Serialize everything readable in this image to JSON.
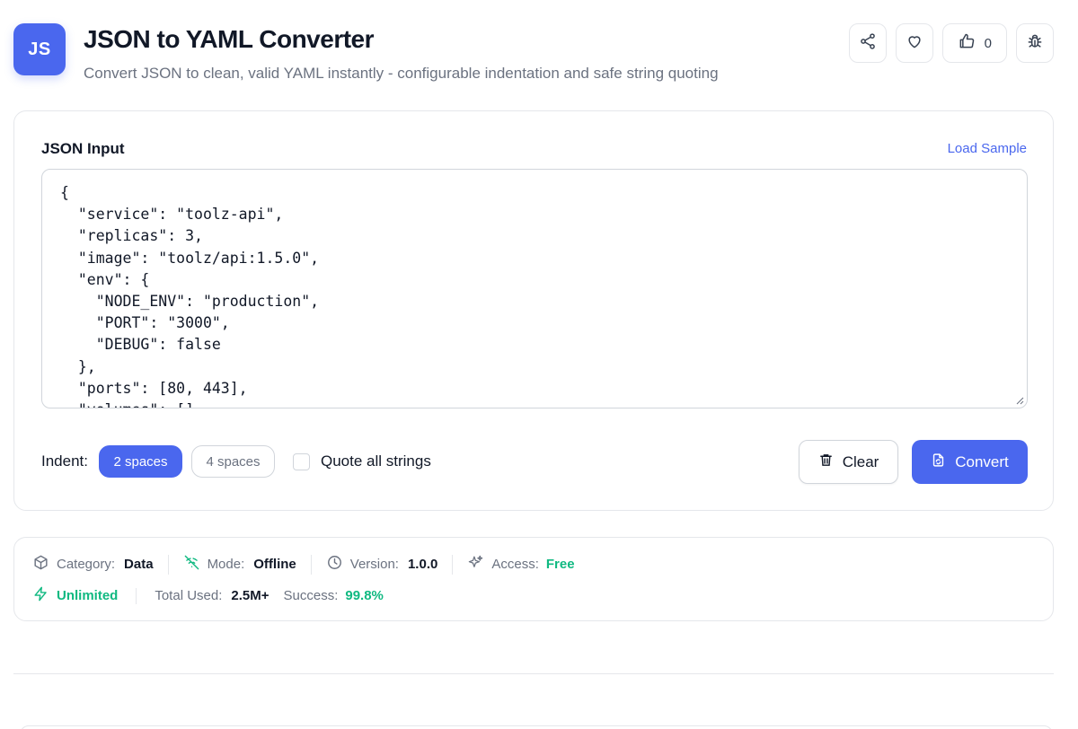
{
  "header": {
    "logo_text": "JS",
    "title": "JSON to YAML Converter",
    "subtitle": "Convert JSON to clean, valid YAML instantly - configurable indentation and safe string quoting",
    "like_count": "0",
    "icons": [
      "share-icon",
      "heart-icon",
      "thumbs-up-icon",
      "bug-icon"
    ]
  },
  "input": {
    "label": "JSON Input",
    "load_sample": "Load Sample",
    "value": "{\n  \"service\": \"toolz-api\",\n  \"replicas\": 3,\n  \"image\": \"toolz/api:1.5.0\",\n  \"env\": {\n    \"NODE_ENV\": \"production\",\n    \"PORT\": \"3000\",\n    \"DEBUG\": false\n  },\n  \"ports\": [80, 443],\n  \"volumes\": []"
  },
  "controls": {
    "indent_label": "Indent:",
    "indent_options": [
      "2 spaces",
      "4 spaces"
    ],
    "indent_selected": "2 spaces",
    "quote_label": "Quote all strings",
    "quote_checked": false,
    "clear_label": "Clear",
    "convert_label": "Convert"
  },
  "meta": {
    "category_label": "Category:",
    "category_value": "Data",
    "mode_label": "Mode:",
    "mode_value": "Offline",
    "version_label": "Version:",
    "version_value": "1.0.0",
    "access_label": "Access:",
    "access_value": "Free",
    "unlimited_label": "Unlimited",
    "total_used_label": "Total Used:",
    "total_used_value": "2.5M+",
    "success_label": "Success:",
    "success_value": "99.8%"
  },
  "colors": {
    "accent": "#4a67ee",
    "success": "#10b981",
    "muted": "#6b7280"
  }
}
